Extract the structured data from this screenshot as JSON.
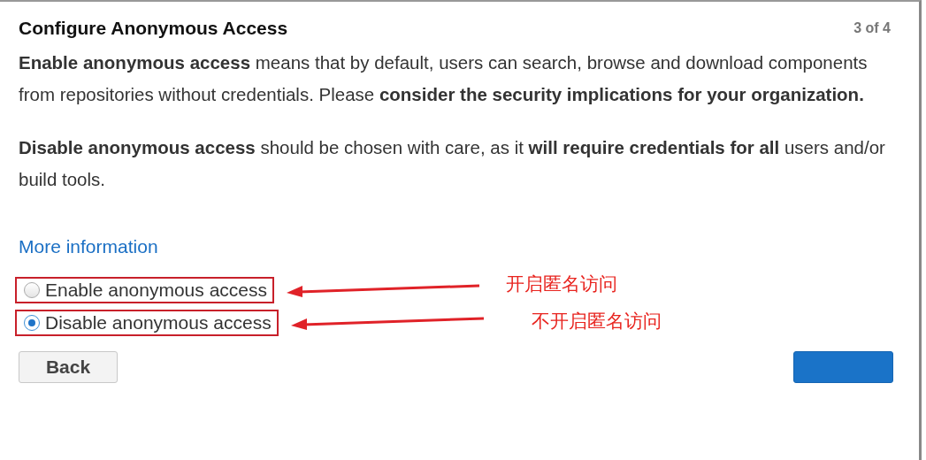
{
  "dialog": {
    "title": "Configure Anonymous Access",
    "step": "3 of 4",
    "paragraphs": [
      "**Enable anonymous access** means that by default, users can search, browse and download components from repositories without credentials. Please **consider the security implications for your organization.**",
      "**Disable anonymous access** should be chosen with care, as it **will require credentials for all** users and/or build tools."
    ],
    "link": "More information",
    "options": [
      {
        "label": "Enable anonymous access",
        "selected": false,
        "highlighted": true,
        "annotation": "开启匿名访问"
      },
      {
        "label": "Disable anonymous access",
        "selected": true,
        "highlighted": true,
        "annotation": "不开启匿名访问"
      }
    ],
    "buttons": [
      {
        "kind": "secondary",
        "label": "Back"
      },
      {
        "kind": "primary"
      }
    ]
  }
}
